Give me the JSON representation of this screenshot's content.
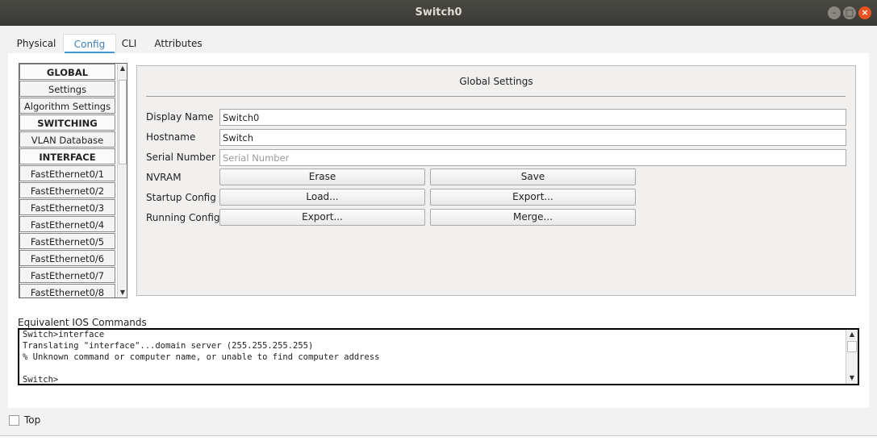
{
  "window": {
    "title": "Switch0"
  },
  "tabs": [
    "Physical",
    "Config",
    "CLI",
    "Attributes"
  ],
  "sidebar": {
    "items": [
      {
        "label": "GLOBAL",
        "header": true
      },
      {
        "label": "Settings"
      },
      {
        "label": "Algorithm Settings"
      },
      {
        "label": "SWITCHING",
        "header": true
      },
      {
        "label": "VLAN Database"
      },
      {
        "label": "INTERFACE",
        "header": true
      },
      {
        "label": "FastEthernet0/1"
      },
      {
        "label": "FastEthernet0/2"
      },
      {
        "label": "FastEthernet0/3"
      },
      {
        "label": "FastEthernet0/4"
      },
      {
        "label": "FastEthernet0/5"
      },
      {
        "label": "FastEthernet0/6"
      },
      {
        "label": "FastEthernet0/7"
      },
      {
        "label": "FastEthernet0/8"
      }
    ]
  },
  "settings": {
    "title": "Global Settings",
    "display_name_label": "Display Name",
    "display_name_value": "Switch0",
    "hostname_label": "Hostname",
    "hostname_value": "Switch",
    "serial_label": "Serial Number",
    "serial_placeholder": "Serial Number",
    "nvram_label": "NVRAM",
    "startup_label": "Startup Config",
    "running_label": "Running Config",
    "erase": "Erase",
    "save": "Save",
    "load": "Load...",
    "export_startup": "Export...",
    "export_running": "Export...",
    "merge": "Merge..."
  },
  "ios": {
    "label": "Equivalent IOS Commands",
    "lines": [
      "Switch>interface",
      "Translating \"interface\"...domain server (255.255.255.255)",
      "% Unknown command or computer name, or unable to find computer address",
      "",
      "Switch>"
    ]
  },
  "footer": {
    "top_label": "Top"
  }
}
